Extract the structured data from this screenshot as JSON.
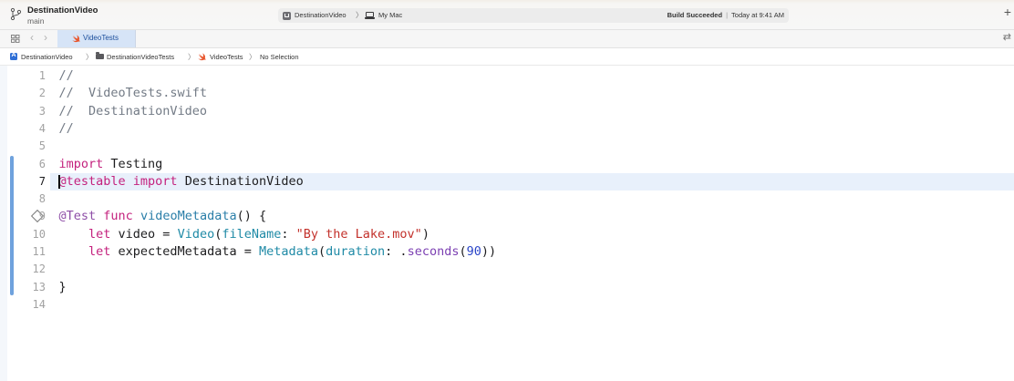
{
  "window": {
    "project_title": "DestinationVideo",
    "branch": "main"
  },
  "activity": {
    "scheme": "DestinationVideo",
    "device": "My Mac",
    "build_status_strong": "Build Succeeded",
    "build_separator": "|",
    "build_time": "Today at 9:41 AM"
  },
  "tabs": [
    {
      "label": "VideoTests",
      "icon": "swift-file-icon",
      "active": true
    }
  ],
  "jumpbar": {
    "project": "DestinationVideo",
    "group": "DestinationVideoTests",
    "file": "VideoTests",
    "selection": "No Selection"
  },
  "editor": {
    "active_line": 7,
    "colors": {
      "comment": "#737b86",
      "keyword": "#c4227e",
      "attribute": "#8e4ea7",
      "type": "#1f8aa6",
      "string": "#c3312b",
      "number": "#2a45c8",
      "current_line_bg": "#e8f0fb",
      "change_bar": "#6fa2dd"
    },
    "lines": [
      {
        "n": "1",
        "tokens": [
          {
            "t": "//",
            "k": "comment"
          }
        ]
      },
      {
        "n": "2",
        "tokens": [
          {
            "t": "//  VideoTests.swift",
            "k": "comment"
          }
        ]
      },
      {
        "n": "3",
        "tokens": [
          {
            "t": "//  DestinationVideo",
            "k": "comment"
          }
        ]
      },
      {
        "n": "4",
        "tokens": [
          {
            "t": "//",
            "k": "comment"
          }
        ]
      },
      {
        "n": "5",
        "tokens": []
      },
      {
        "n": "6",
        "tokens": [
          {
            "t": "import",
            "k": "keyword"
          },
          {
            "t": " Testing",
            "k": "plain"
          }
        ]
      },
      {
        "n": "7",
        "tokens": [
          {
            "t": "@testable",
            "k": "keyword"
          },
          {
            "t": " ",
            "k": "plain"
          },
          {
            "t": "import",
            "k": "keyword"
          },
          {
            "t": " DestinationVideo",
            "k": "plain"
          }
        ]
      },
      {
        "n": "8",
        "tokens": []
      },
      {
        "n": "9",
        "tokens": [
          {
            "t": "@Test",
            "k": "attr"
          },
          {
            "t": " ",
            "k": "plain"
          },
          {
            "t": "func",
            "k": "keyword"
          },
          {
            "t": " ",
            "k": "plain"
          },
          {
            "t": "videoMetadata",
            "k": "fn"
          },
          {
            "t": "() {",
            "k": "plain"
          }
        ]
      },
      {
        "n": "10",
        "tokens": [
          {
            "t": "    ",
            "k": "plain"
          },
          {
            "t": "let",
            "k": "keyword"
          },
          {
            "t": " video = ",
            "k": "plain"
          },
          {
            "t": "Video",
            "k": "type"
          },
          {
            "t": "(",
            "k": "plain"
          },
          {
            "t": "fileName",
            "k": "type"
          },
          {
            "t": ": ",
            "k": "plain"
          },
          {
            "t": "\"By the Lake.mov\"",
            "k": "string"
          },
          {
            "t": ")",
            "k": "plain"
          }
        ]
      },
      {
        "n": "11",
        "tokens": [
          {
            "t": "    ",
            "k": "plain"
          },
          {
            "t": "let",
            "k": "keyword"
          },
          {
            "t": " expectedMetadata = ",
            "k": "plain"
          },
          {
            "t": "Metadata",
            "k": "type"
          },
          {
            "t": "(",
            "k": "plain"
          },
          {
            "t": "duration",
            "k": "type"
          },
          {
            "t": ": .",
            "k": "plain"
          },
          {
            "t": "seconds",
            "k": "method"
          },
          {
            "t": "(",
            "k": "plain"
          },
          {
            "t": "90",
            "k": "number"
          },
          {
            "t": "))",
            "k": "plain"
          }
        ]
      },
      {
        "n": "12",
        "tokens": []
      },
      {
        "n": "13",
        "tokens": [
          {
            "t": "}",
            "k": "plain"
          }
        ]
      },
      {
        "n": "14",
        "tokens": []
      }
    ]
  }
}
